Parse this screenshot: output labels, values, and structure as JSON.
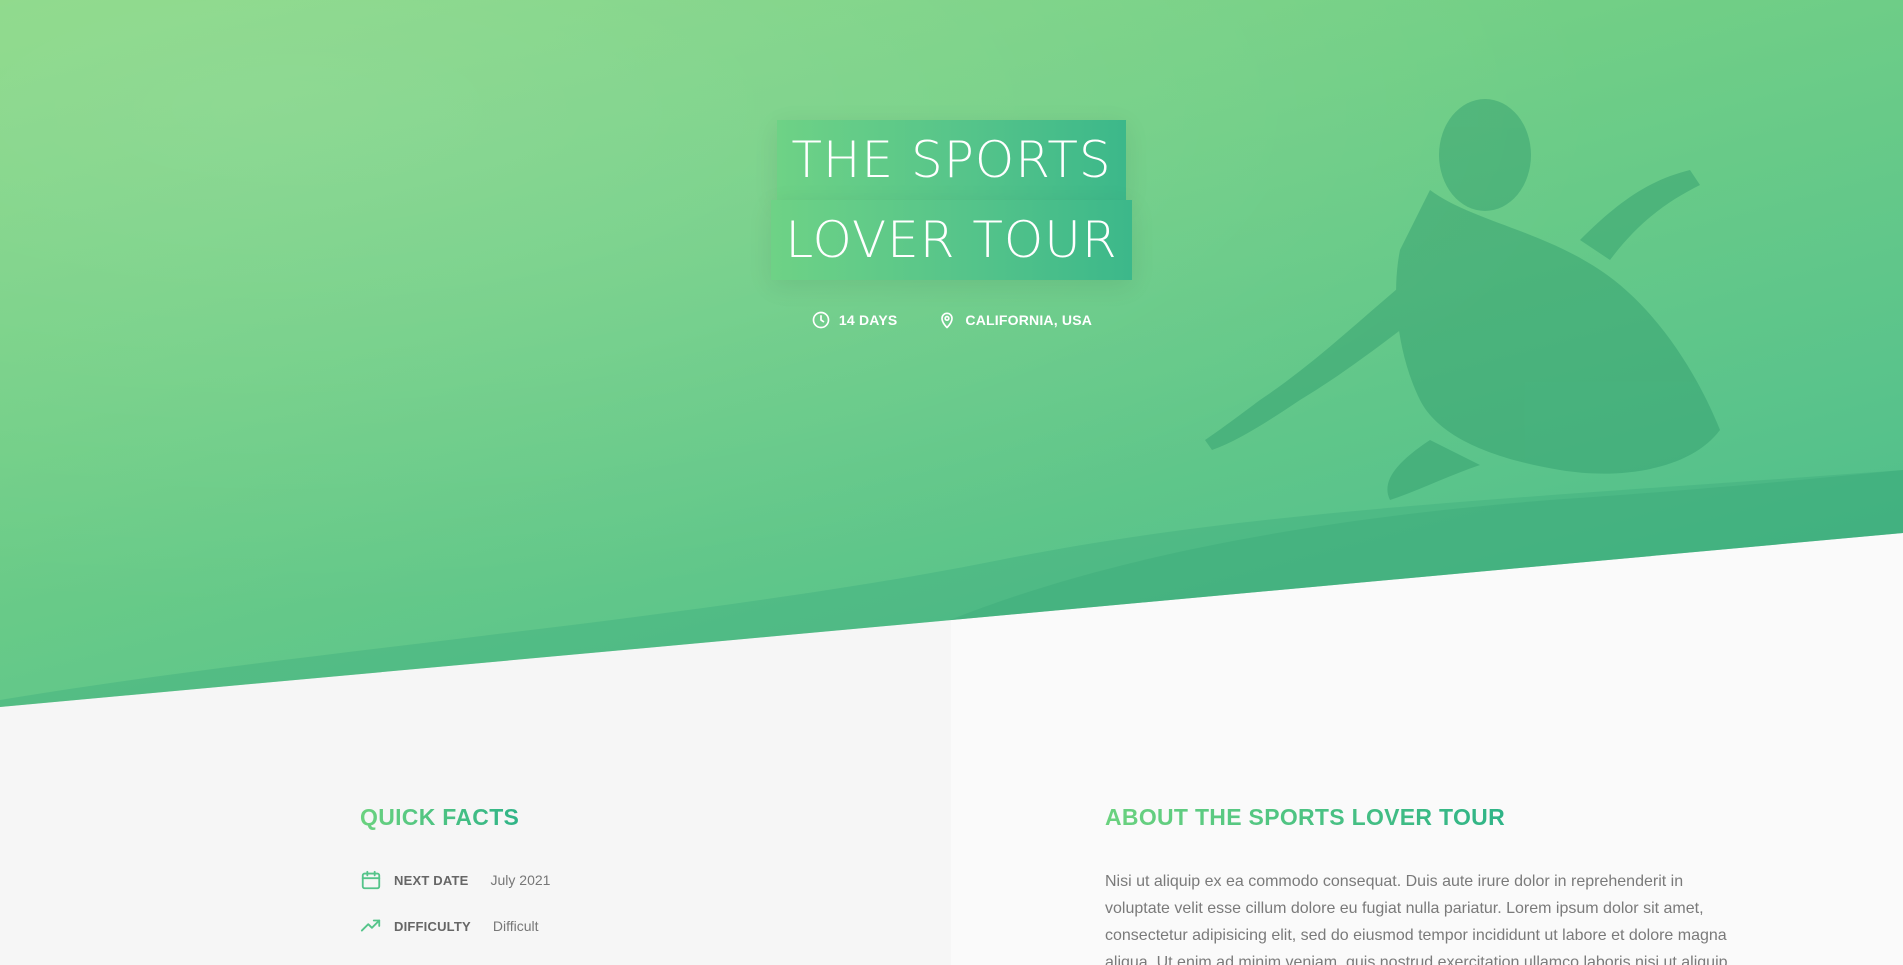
{
  "hero": {
    "title_line_1": "THE SPORTS",
    "title_line_2": "LOVER TOUR",
    "meta": {
      "duration": "14 DAYS",
      "location": "CALIFORNIA, USA"
    },
    "icons": {
      "duration": "clock-icon",
      "location": "map-pin-icon"
    }
  },
  "quick_facts": {
    "title": "QUICK FACTS",
    "items": [
      {
        "icon": "calendar-icon",
        "label": "NEXT DATE",
        "value": "July 2021"
      },
      {
        "icon": "trending-up-icon",
        "label": "DIFFICULTY",
        "value": "Difficult"
      }
    ]
  },
  "about": {
    "title": "ABOUT THE SPORTS LOVER TOUR",
    "text": "Nisi ut aliquip ex ea commodo consequat. Duis aute irure dolor in reprehenderit in voluptate velit esse cillum dolore eu fugiat nulla pariatur. Lorem ipsum dolor sit amet, consectetur adipisicing elit, sed do eiusmod tempor incididunt ut labore et dolore magna aliqua. Ut enim ad minim veniam, quis nostrud exercitation ullamco laboris nisi ut aliquip"
  },
  "colors": {
    "accent_light": "#6bd27f",
    "accent_dark": "#2fb487",
    "hero_top": "#87d783",
    "hero_bottom": "#46b98a"
  }
}
